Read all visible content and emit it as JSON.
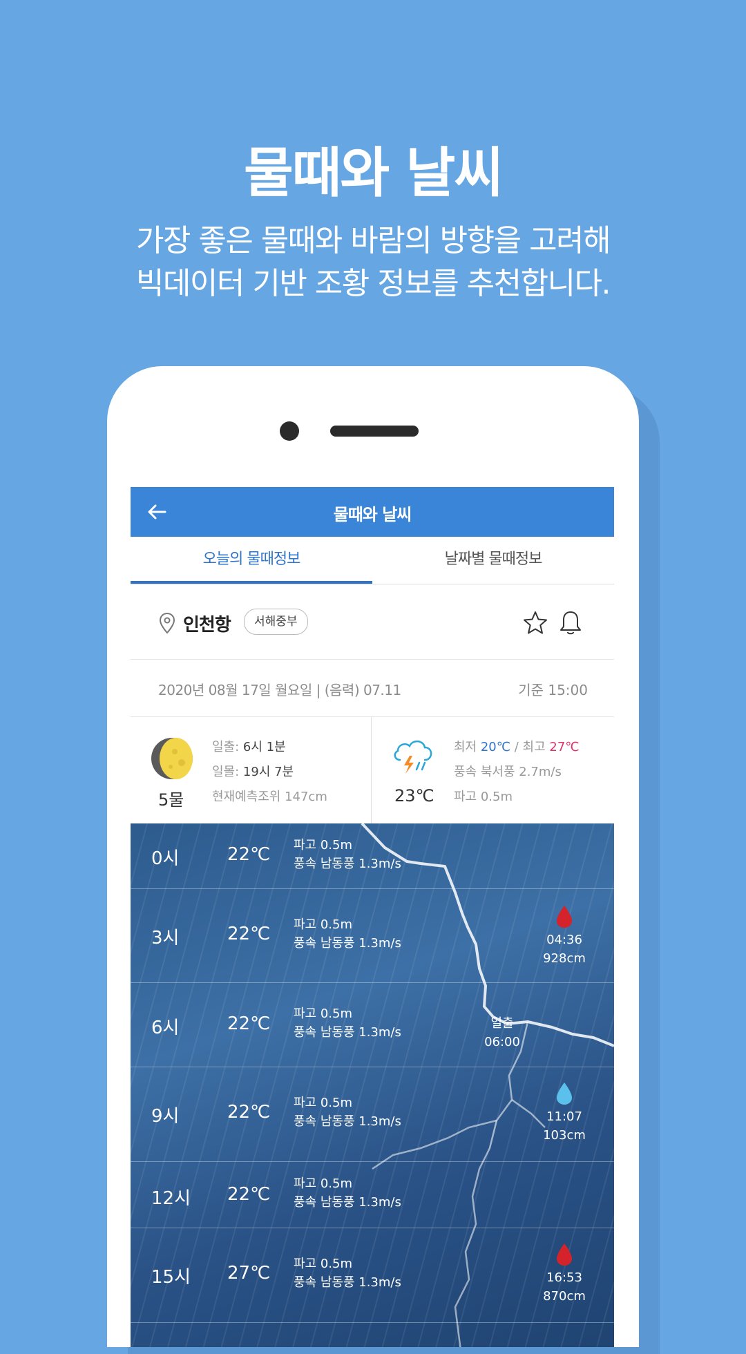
{
  "hero": {
    "title": "물때와 날씨",
    "subtitle_line1": "가장 좋은 물때와 바람의 방향을 고려해",
    "subtitle_line2": "빅데이터 기반 조황 정보를 추천합니다."
  },
  "appbar": {
    "title": "물때와 날씨",
    "back_icon": "arrow-left-icon"
  },
  "tabs": [
    {
      "label": "오늘의 물때정보",
      "active": true
    },
    {
      "label": "날짜별 물때정보",
      "active": false
    }
  ],
  "location": {
    "name": "인천항",
    "region": "서해중부"
  },
  "date": {
    "text": "2020년 08월 17일 월요일 | (음력) 07.11",
    "base_time": "기준 15:00"
  },
  "tide_summary": {
    "tide_level": "5물",
    "sunrise_label": "일출:",
    "sunrise": "6시 1분",
    "sunset_label": "일몰:",
    "sunset": "19시 7분",
    "prediction": "현재예측조위 147cm"
  },
  "weather_summary": {
    "temp": "23℃",
    "min_label": "최저",
    "min": "20℃",
    "sep": "/",
    "max_label": "최고",
    "max": "27℃",
    "wind": "풍속 북서풍 2.7m/s",
    "wave": "파고 0.5m"
  },
  "colors": {
    "accent": "#3a85d7",
    "min_temp": "#2f74c9",
    "max_temp": "#e0306a",
    "high_tide": "#d4232b",
    "low_tide": "#5bc0eb"
  },
  "hourly": [
    {
      "time": "0시",
      "temp": "22℃",
      "wave": "파고 0.5m",
      "wind": "풍속 남동풍 1.3m/s"
    },
    {
      "time": "3시",
      "temp": "22℃",
      "wave": "파고 0.5m",
      "wind": "풍속 남동풍 1.3m/s",
      "tide": {
        "type": "high",
        "time": "04:36",
        "level": "928cm"
      }
    },
    {
      "time": "6시",
      "temp": "22℃",
      "wave": "파고 0.5m",
      "wind": "풍속 남동풍 1.3m/s",
      "sun": {
        "label": "일출",
        "time": "06:00"
      }
    },
    {
      "time": "9시",
      "temp": "22℃",
      "wave": "파고 0.5m",
      "wind": "풍속 남동풍 1.3m/s",
      "tide": {
        "type": "low",
        "time": "11:07",
        "level": "103cm"
      }
    },
    {
      "time": "12시",
      "temp": "22℃",
      "wave": "파고 0.5m",
      "wind": "풍속 남동풍 1.3m/s"
    },
    {
      "time": "15시",
      "temp": "27℃",
      "wave": "파고 0.5m",
      "wind": "풍속 남동풍 1.3m/s",
      "tide": {
        "type": "high",
        "time": "16:53",
        "level": "870cm"
      }
    }
  ]
}
